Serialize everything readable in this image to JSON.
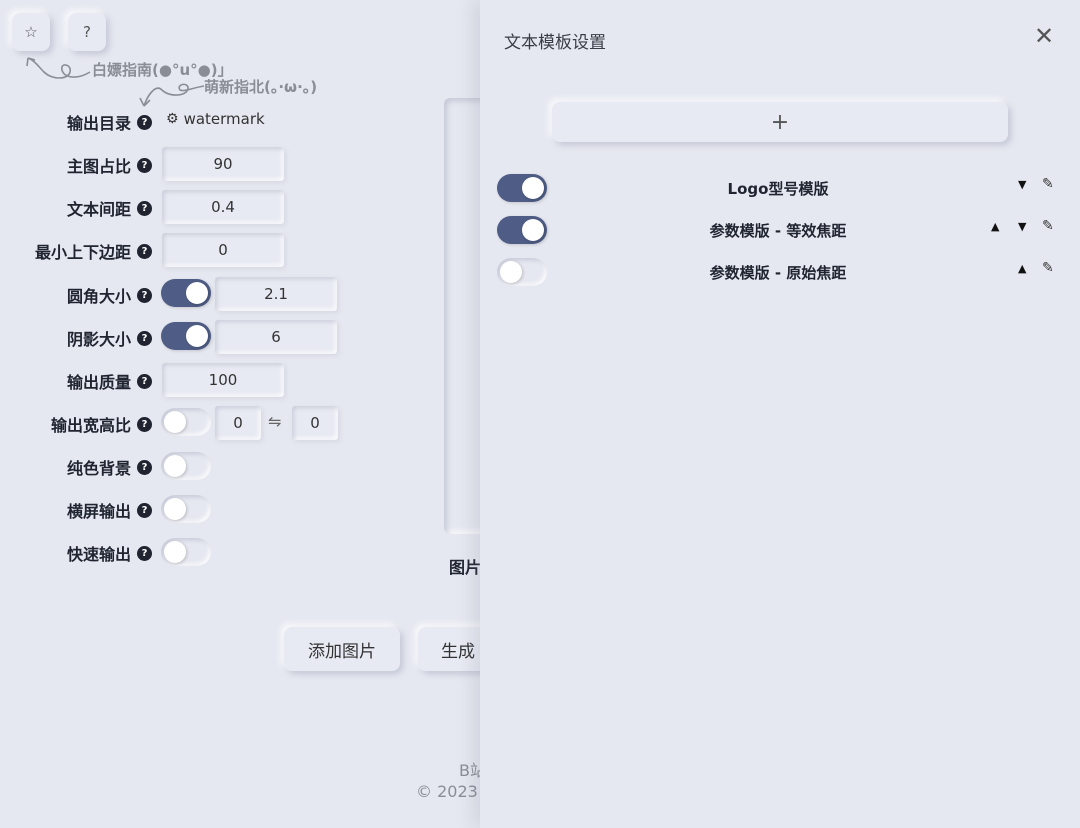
{
  "toolbar": {
    "star_label": "☆",
    "help_label": "?"
  },
  "hints": {
    "guide1": "白嫖指南(●°u°●)」",
    "guide2": "萌新指北(。·ω·。)"
  },
  "settings": {
    "output_dir": {
      "label": "输出目录",
      "value": "watermark"
    },
    "main_ratio": {
      "label": "主图占比",
      "value": "90"
    },
    "text_spacing": {
      "label": "文本间距",
      "value": "0.4"
    },
    "min_margin": {
      "label": "最小上下边距",
      "value": "0"
    },
    "corner_radius": {
      "label": "圆角大小",
      "value": "2.1",
      "enabled": true
    },
    "shadow_size": {
      "label": "阴影大小",
      "value": "6",
      "enabled": true
    },
    "output_quality": {
      "label": "输出质量",
      "value": "100"
    },
    "aspect_ratio": {
      "label": "输出宽高比",
      "enabled": false,
      "w": "0",
      "swap": "⇋",
      "h": "0"
    },
    "solid_bg": {
      "label": "纯色背景",
      "enabled": false
    },
    "landscape": {
      "label": "横屏输出",
      "enabled": false
    },
    "fast_output": {
      "label": "快速输出",
      "enabled": false
    }
  },
  "preview_label": "图片",
  "buttons": {
    "add_image": "添加图片",
    "generate": "生成"
  },
  "footer": {
    "line1": "B站",
    "line2": "© 2023"
  },
  "panel": {
    "title": "文本模板设置",
    "close": "✕",
    "add": "+",
    "templates": [
      {
        "name": "Logo型号模版",
        "enabled": true,
        "up": false,
        "down": true
      },
      {
        "name": "参数模版 - 等效焦距",
        "enabled": true,
        "up": true,
        "down": true
      },
      {
        "name": "参数模版 - 原始焦距",
        "enabled": false,
        "up": true,
        "down": false
      }
    ]
  },
  "colors": {
    "accent": "#4f5d86",
    "background": "#e6e8f1"
  }
}
